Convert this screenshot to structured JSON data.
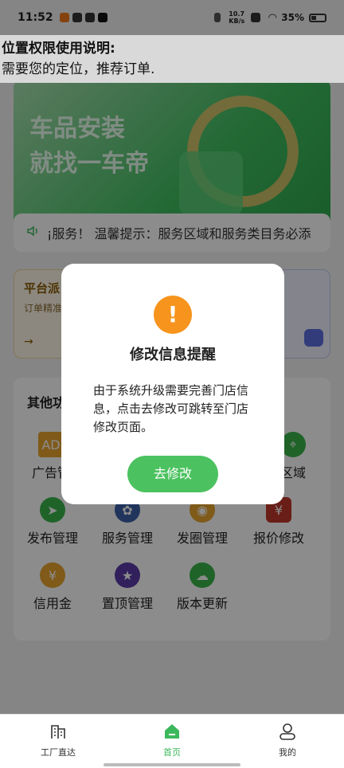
{
  "status": {
    "time": "11:52",
    "net_speed": "10.7 KB/s",
    "battery": "35%"
  },
  "permission": {
    "title": "位置权限使用说明:",
    "text": "需要您的定位，推荐订单."
  },
  "banner": {
    "line1": "车品安装",
    "line2": "就找一车帝"
  },
  "notice": {
    "text": "¡服务！ 温馨提示：服务区域和服务类目务必添"
  },
  "cards": {
    "left_title": "平台派",
    "left_sub": "订单精准",
    "left_arrow": "→"
  },
  "panel": {
    "title": "其他功",
    "items": [
      {
        "label": "广告管",
        "icon": "ad-icon",
        "color": "#e7a52f"
      },
      {
        "label": "区域",
        "icon": "region-icon",
        "color": "#39b54a"
      },
      {
        "label": "发布管理",
        "icon": "send-icon",
        "color": "#39b54a"
      },
      {
        "label": "服务管理",
        "icon": "service-icon",
        "color": "#3b5fa8"
      },
      {
        "label": "发圈管理",
        "icon": "circle-icon",
        "color": "#e7a52f"
      },
      {
        "label": "报价修改",
        "icon": "price-icon",
        "color": "#c0392b"
      },
      {
        "label": "信用金",
        "icon": "credit-icon",
        "color": "#e7a52f"
      },
      {
        "label": "置顶管理",
        "icon": "top-icon",
        "color": "#5b3ba8"
      },
      {
        "label": "版本更新",
        "icon": "update-icon",
        "color": "#39b54a"
      }
    ]
  },
  "dialog": {
    "icon": "!",
    "title": "修改信息提醒",
    "text": "由于系统升级需要完善门店信息，点击去修改可跳转至门店修改页面。",
    "button": "去修改"
  },
  "tabs": [
    {
      "label": "工厂直达",
      "icon": "factory-icon"
    },
    {
      "label": "首页",
      "icon": "home-icon",
      "active": true
    },
    {
      "label": "我的",
      "icon": "profile-icon"
    }
  ]
}
